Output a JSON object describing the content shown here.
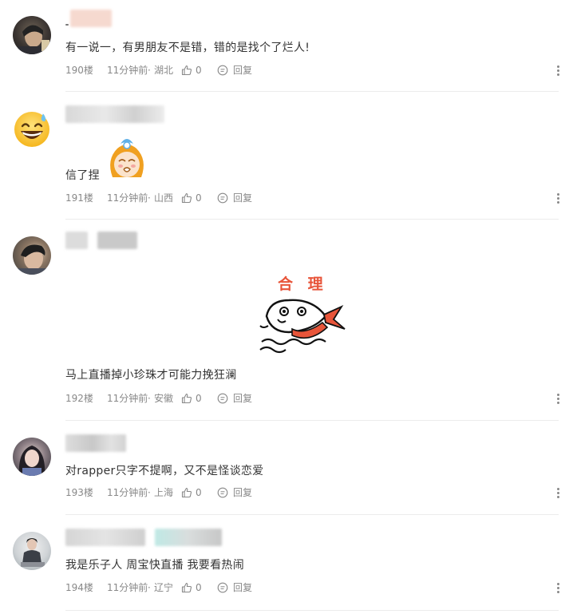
{
  "comments": [
    {
      "text": "有一说一，有男朋友不是错，错的是找个了烂人!",
      "floor": "190楼",
      "time": "11分钟前",
      "dot": "·",
      "location": "湖北",
      "likes": "0",
      "reply_label": "回复"
    },
    {
      "text": "信了捏",
      "floor": "191楼",
      "time": "11分钟前",
      "dot": "·",
      "location": "山西",
      "likes": "0",
      "reply_label": "回复"
    },
    {
      "text": "马上直播掉小珍珠才可能力挽狂澜",
      "floor": "192楼",
      "time": "11分钟前",
      "dot": "·",
      "location": "安徽",
      "likes": "0",
      "reply_label": "回复",
      "sticker_text": "合 理"
    },
    {
      "text": "对rapper只字不提啊，又不是怪谈恋爱",
      "floor": "193楼",
      "time": "11分钟前",
      "dot": "·",
      "location": "上海",
      "likes": "0",
      "reply_label": "回复"
    },
    {
      "text": "我是乐子人 周宝快直播 我要看热闹",
      "floor": "194楼",
      "time": "11分钟前",
      "dot": "·",
      "location": "辽宁",
      "likes": "0",
      "reply_label": "回复"
    }
  ],
  "colors": {
    "meta_text": "#888888",
    "sticker_accent": "#e8553a",
    "divider": "#ececec"
  }
}
